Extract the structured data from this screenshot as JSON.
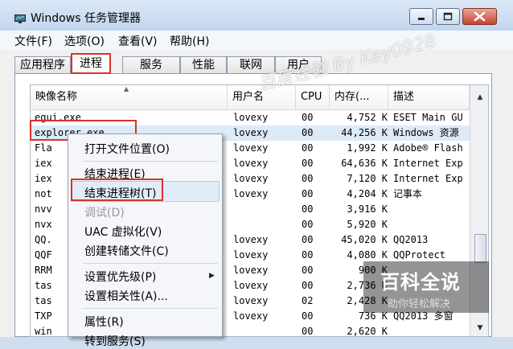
{
  "window": {
    "title": "Windows 任务管理器"
  },
  "menu": [
    "文件(F)",
    "选项(O)",
    "查看(V)",
    "帮助(H)"
  ],
  "tabs": [
    "应用程序",
    "进程",
    "服务",
    "性能",
    "联网",
    "用户"
  ],
  "active_tab": "进程",
  "columns": [
    "映像名称",
    "用户名",
    "CPU",
    "内存(...",
    "描述"
  ],
  "rows": [
    [
      "egui.exe",
      "lovexy",
      "00",
      "4,752 K",
      "ESET Main GU"
    ],
    [
      "explorer.exe",
      "lovexy",
      "00",
      "44,256 K",
      "Windows 资源"
    ],
    [
      "Fla",
      "lovexy",
      "00",
      "1,992 K",
      "Adobe® Flash"
    ],
    [
      "iex",
      "lovexy",
      "00",
      "64,636 K",
      "Internet Exp"
    ],
    [
      "iex",
      "lovexy",
      "00",
      "7,120 K",
      "Internet Exp"
    ],
    [
      "not",
      "lovexy",
      "00",
      "4,204 K",
      "记事本"
    ],
    [
      "nvv",
      "",
      "00",
      "3,916 K",
      ""
    ],
    [
      "nvx",
      "",
      "00",
      "5,920 K",
      ""
    ],
    [
      "QQ.",
      "lovexy",
      "00",
      "45,020 K",
      "QQ2013"
    ],
    [
      "QQF",
      "lovexy",
      "00",
      "4,080 K",
      "QQProtect"
    ],
    [
      "RRM",
      "lovexy",
      "00",
      "900 K",
      ""
    ],
    [
      "tas",
      "lovexy",
      "00",
      "2,736 K",
      ""
    ],
    [
      "tas",
      "lovexy",
      "02",
      "2,428 K",
      ""
    ],
    [
      "TXP",
      "lovexy",
      "00",
      "736 K",
      "QQ2013 多窗"
    ],
    [
      "win",
      "",
      "00",
      "2,620 K",
      ""
    ]
  ],
  "context_menu": [
    {
      "label": "打开文件位置(O)",
      "disabled": false
    },
    {
      "label": "结束进程(E)",
      "disabled": false
    },
    {
      "label": "结束进程树(T)",
      "disabled": false
    },
    {
      "label": "调试(D)",
      "disabled": true
    },
    {
      "label": "UAC 虚拟化(V)",
      "disabled": false
    },
    {
      "label": "创建转储文件(C)",
      "disabled": false
    },
    {
      "label": "设置优先级(P)",
      "disabled": false
    },
    {
      "label": "设置相关性(A)...",
      "disabled": false
    },
    {
      "label": "属性(R)",
      "disabled": false
    },
    {
      "label": "转到服务(S)",
      "disabled": false
    }
  ],
  "watermark": {
    "title": "百科全说",
    "subtitle": "助你轻松解决",
    "corner": "百度经验 By Key0928"
  },
  "colors": {
    "highlight_box": "#d8322a",
    "selection": "#ddeaf8",
    "watermark_green": "#1e8f3c"
  }
}
